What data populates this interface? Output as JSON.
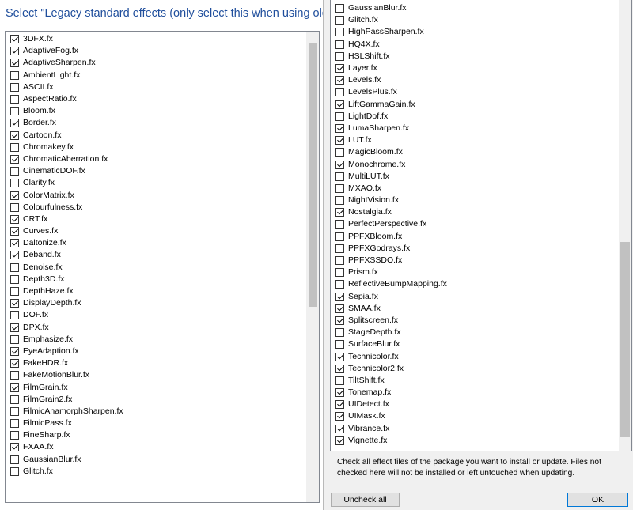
{
  "left": {
    "header": "Select \"Legacy standard effects (only select this when using old pres",
    "items": [
      {
        "label": "3DFX.fx",
        "checked": true
      },
      {
        "label": "AdaptiveFog.fx",
        "checked": true
      },
      {
        "label": "AdaptiveSharpen.fx",
        "checked": true
      },
      {
        "label": "AmbientLight.fx",
        "checked": false
      },
      {
        "label": "ASCII.fx",
        "checked": false
      },
      {
        "label": "AspectRatio.fx",
        "checked": false
      },
      {
        "label": "Bloom.fx",
        "checked": false
      },
      {
        "label": "Border.fx",
        "checked": true
      },
      {
        "label": "Cartoon.fx",
        "checked": true
      },
      {
        "label": "Chromakey.fx",
        "checked": false
      },
      {
        "label": "ChromaticAberration.fx",
        "checked": true
      },
      {
        "label": "CinematicDOF.fx",
        "checked": false
      },
      {
        "label": "Clarity.fx",
        "checked": false
      },
      {
        "label": "ColorMatrix.fx",
        "checked": true
      },
      {
        "label": "Colourfulness.fx",
        "checked": false
      },
      {
        "label": "CRT.fx",
        "checked": true
      },
      {
        "label": "Curves.fx",
        "checked": true
      },
      {
        "label": "Daltonize.fx",
        "checked": true
      },
      {
        "label": "Deband.fx",
        "checked": true
      },
      {
        "label": "Denoise.fx",
        "checked": false
      },
      {
        "label": "Depth3D.fx",
        "checked": false
      },
      {
        "label": "DepthHaze.fx",
        "checked": false
      },
      {
        "label": "DisplayDepth.fx",
        "checked": true
      },
      {
        "label": "DOF.fx",
        "checked": false
      },
      {
        "label": "DPX.fx",
        "checked": true
      },
      {
        "label": "Emphasize.fx",
        "checked": false
      },
      {
        "label": "EyeAdaption.fx",
        "checked": true
      },
      {
        "label": "FakeHDR.fx",
        "checked": true
      },
      {
        "label": "FakeMotionBlur.fx",
        "checked": false
      },
      {
        "label": "FilmGrain.fx",
        "checked": true
      },
      {
        "label": "FilmGrain2.fx",
        "checked": false
      },
      {
        "label": "FilmicAnamorphSharpen.fx",
        "checked": false
      },
      {
        "label": "FilmicPass.fx",
        "checked": false
      },
      {
        "label": "FineSharp.fx",
        "checked": false
      },
      {
        "label": "FXAA.fx",
        "checked": true
      },
      {
        "label": "GaussianBlur.fx",
        "checked": false
      },
      {
        "label": "Glitch.fx",
        "checked": false
      }
    ]
  },
  "right": {
    "items": [
      {
        "label": "GaussianBlur.fx",
        "checked": false
      },
      {
        "label": "Glitch.fx",
        "checked": false
      },
      {
        "label": "HighPassSharpen.fx",
        "checked": false
      },
      {
        "label": "HQ4X.fx",
        "checked": false
      },
      {
        "label": "HSLShift.fx",
        "checked": false
      },
      {
        "label": "Layer.fx",
        "checked": true
      },
      {
        "label": "Levels.fx",
        "checked": true
      },
      {
        "label": "LevelsPlus.fx",
        "checked": false
      },
      {
        "label": "LiftGammaGain.fx",
        "checked": true
      },
      {
        "label": "LightDof.fx",
        "checked": false
      },
      {
        "label": "LumaSharpen.fx",
        "checked": true
      },
      {
        "label": "LUT.fx",
        "checked": true
      },
      {
        "label": "MagicBloom.fx",
        "checked": false
      },
      {
        "label": "Monochrome.fx",
        "checked": true
      },
      {
        "label": "MultiLUT.fx",
        "checked": false
      },
      {
        "label": "MXAO.fx",
        "checked": false
      },
      {
        "label": "NightVision.fx",
        "checked": false
      },
      {
        "label": "Nostalgia.fx",
        "checked": true
      },
      {
        "label": "PerfectPerspective.fx",
        "checked": false
      },
      {
        "label": "PPFXBloom.fx",
        "checked": false
      },
      {
        "label": "PPFXGodrays.fx",
        "checked": false
      },
      {
        "label": "PPFXSSDO.fx",
        "checked": false
      },
      {
        "label": "Prism.fx",
        "checked": false
      },
      {
        "label": "ReflectiveBumpMapping.fx",
        "checked": false
      },
      {
        "label": "Sepia.fx",
        "checked": true
      },
      {
        "label": "SMAA.fx",
        "checked": true
      },
      {
        "label": "Splitscreen.fx",
        "checked": true
      },
      {
        "label": "StageDepth.fx",
        "checked": false
      },
      {
        "label": "SurfaceBlur.fx",
        "checked": false
      },
      {
        "label": "Technicolor.fx",
        "checked": true
      },
      {
        "label": "Technicolor2.fx",
        "checked": true
      },
      {
        "label": "TiltShift.fx",
        "checked": false
      },
      {
        "label": "Tonemap.fx",
        "checked": true
      },
      {
        "label": "UIDetect.fx",
        "checked": true
      },
      {
        "label": "UIMask.fx",
        "checked": true
      },
      {
        "label": "Vibrance.fx",
        "checked": true
      },
      {
        "label": "Vignette.fx",
        "checked": true
      }
    ],
    "hint": "Check all effect files of the package you want to install or update. Files not checked here will not be installed or left untouched when updating.",
    "uncheck_label": "Uncheck all",
    "ok_label": "OK"
  }
}
